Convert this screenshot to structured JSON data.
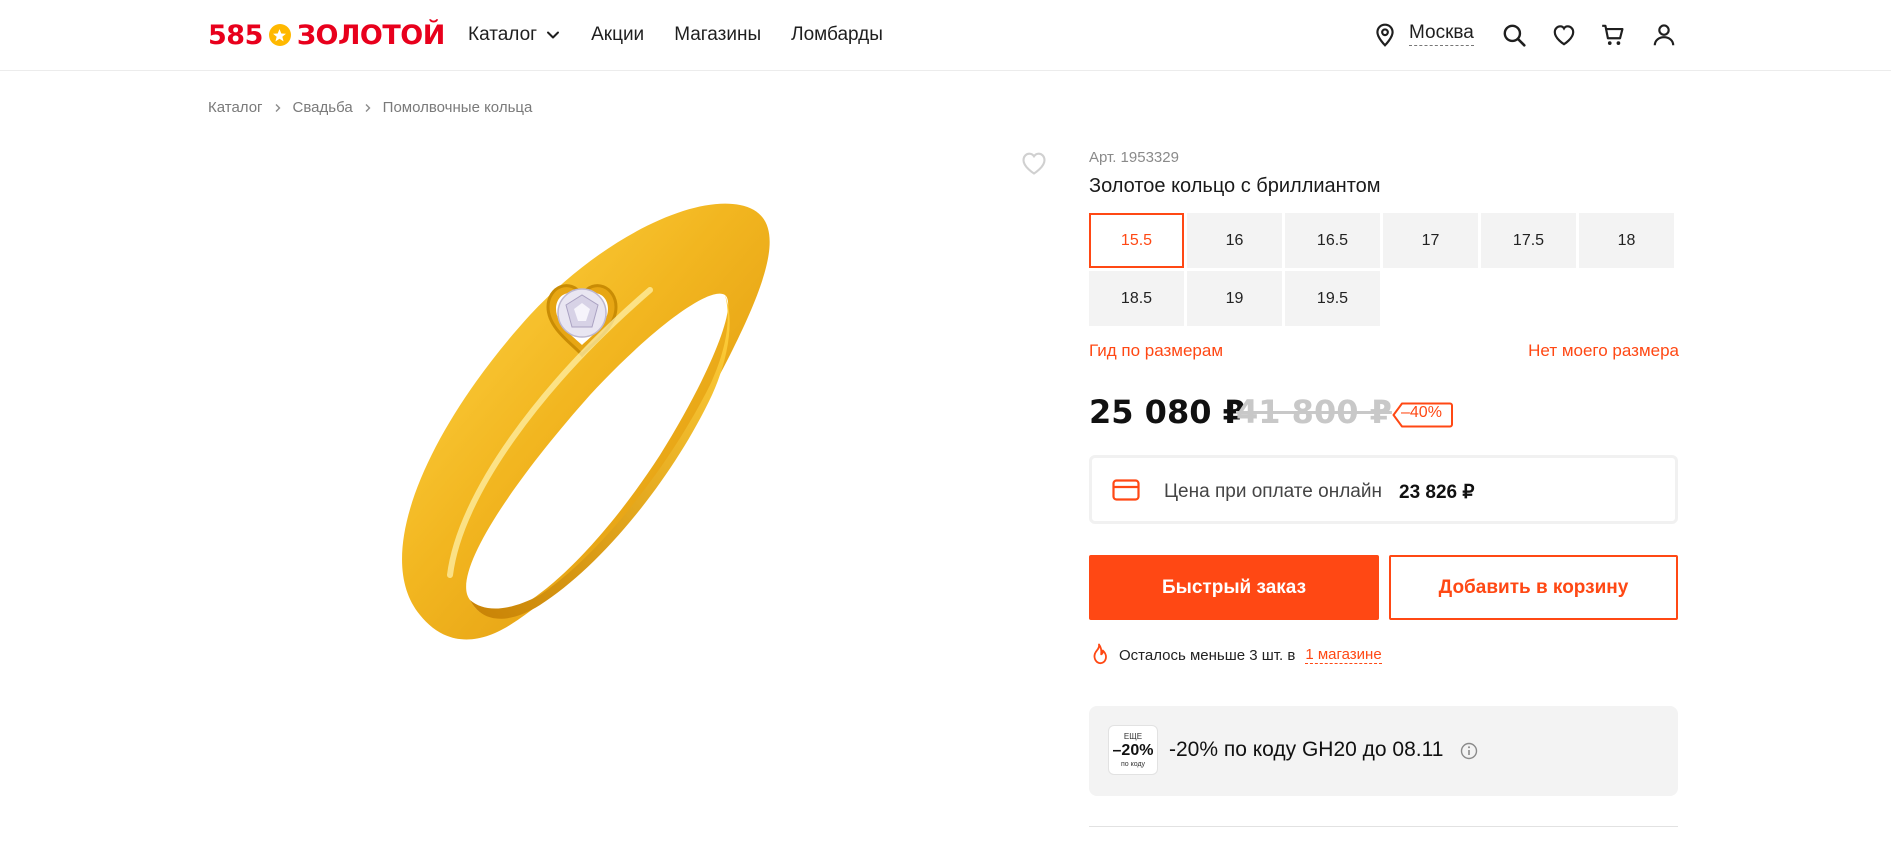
{
  "header": {
    "logo_number": "585",
    "logo_text": "ЗОЛОТОЙ",
    "nav": [
      {
        "label": "Каталог"
      },
      {
        "label": "Акции"
      },
      {
        "label": "Магазины"
      },
      {
        "label": "Ломбарды"
      }
    ],
    "city": "Москва"
  },
  "breadcrumb": [
    "Каталог",
    "Свадьба",
    "Помолвочные кольца"
  ],
  "product": {
    "article": "Арт. 1953329",
    "title": "Золотое кольцо с бриллиантом",
    "sizes": [
      "15.5",
      "16",
      "16.5",
      "17",
      "17.5",
      "18",
      "18.5",
      "19",
      "19.5"
    ],
    "selected_size": "15.5",
    "size_guide": "Гид по размерам",
    "no_size": "Нет моего размера",
    "price": "25 080 ₽",
    "old_price": "41 800 ₽",
    "discount": "–40%",
    "online_label": "Цена при оплате онлайн",
    "online_price": "23 826 ₽",
    "quick_order": "Быстрый заказ",
    "add_to_cart": "Добавить в корзину",
    "stock_text": "Осталось меньше 3 шт. в",
    "stock_link": "1 магазине",
    "promo_badge_top": "ЕЩЕ",
    "promo_badge_value": "–20%",
    "promo_badge_bottom": "по коду",
    "promo_text": "-20% по коду GH20 до 08.11"
  },
  "colors": {
    "accent": "#ff4814",
    "logo_red": "#e8001c",
    "logo_star": "#ffb800",
    "gold": "#f2b620"
  },
  "icons": [
    "location-pin-icon",
    "search-icon",
    "heart-icon",
    "cart-icon",
    "user-icon",
    "card-icon",
    "fire-icon",
    "info-icon",
    "chevron-down-icon",
    "chevron-right-icon"
  ]
}
